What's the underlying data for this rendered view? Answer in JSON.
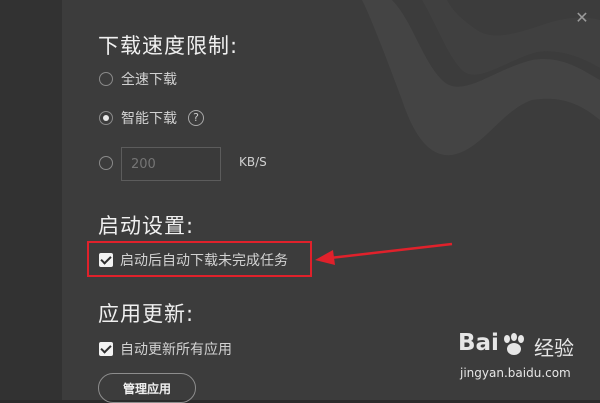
{
  "window": {
    "close_icon": "close-icon"
  },
  "download_speed": {
    "title": "下载速度限制:",
    "options": [
      {
        "label": "全速下载",
        "checked": false
      },
      {
        "label": "智能下载",
        "checked": true,
        "help_icon": "?"
      },
      {
        "label": "",
        "checked": false
      }
    ],
    "limit_value": "200",
    "unit": "KB/S"
  },
  "startup": {
    "title": "启动设置:",
    "auto_resume_label": "启动后自动下载未完成任务",
    "auto_resume_checked": true
  },
  "update": {
    "title": "应用更新:",
    "auto_update_label": "自动更新所有应用",
    "auto_update_checked": true,
    "manage_button": "管理应用"
  },
  "annotation": {
    "box_color": "#e0212b",
    "arrow_color": "#e0212b"
  },
  "watermark": {
    "logo": "Bai",
    "brand": "经验",
    "url": "jingyan.baidu.com"
  }
}
